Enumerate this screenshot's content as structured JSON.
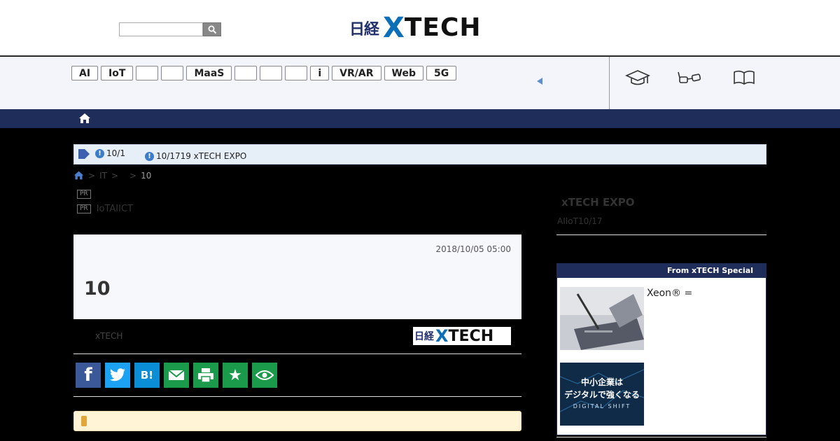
{
  "header": {
    "search": {
      "placeholder": "",
      "button_icon": "search-icon"
    },
    "logo": {
      "nikkei": "日経",
      "x": "X",
      "tech": "TECH"
    }
  },
  "tags": [
    "AI",
    "IoT",
    "",
    "",
    "MaaS",
    "",
    "",
    "",
    "i",
    "VR/AR",
    "Web",
    "5G"
  ],
  "services": [
    "graduation-cap-icon",
    "glasses-icon",
    "open-book-icon"
  ],
  "notice": {
    "item1": "10/1",
    "item2": "10/1719 xTECH EXPO",
    "alert_glyph": "!"
  },
  "breadcrumb": {
    "sep1": ">",
    "cat": "IT",
    "sep2": ">",
    "sep3": ">",
    "current": "10"
  },
  "pr": {
    "badge": "PR",
    "line1": "",
    "line2": "IoTAIICT"
  },
  "article": {
    "date": "2018/10/05 05:00",
    "title": "10",
    "byline": "xTECH",
    "logo": {
      "nikkei": "日経",
      "x": "X",
      "tech": "TECH"
    }
  },
  "share": [
    {
      "icon": "facebook-icon",
      "label": "f",
      "color": "#3b5998"
    },
    {
      "icon": "twitter-icon",
      "label": "",
      "color": "#1da1f2"
    },
    {
      "icon": "hatena-icon",
      "label": "B!",
      "color": "#0a8fd6"
    },
    {
      "icon": "mail-icon",
      "label": "",
      "color": "#1a9a4a"
    },
    {
      "icon": "print-icon",
      "label": "",
      "color": "#1a9a4a"
    },
    {
      "icon": "star-icon",
      "label": "★",
      "color": "#1a9a4a"
    },
    {
      "icon": "eye-icon",
      "label": "",
      "color": "#1a9a4a"
    }
  ],
  "sidebar": {
    "title": "xTECH EXPO",
    "subtitle": "AIIoT10/17",
    "special_header": "From xTECH Special",
    "special_item1": "Xeon® =",
    "special_item2_image_text": "中小企業は デジタルで強くなる DIGITAL SHIFT"
  }
}
